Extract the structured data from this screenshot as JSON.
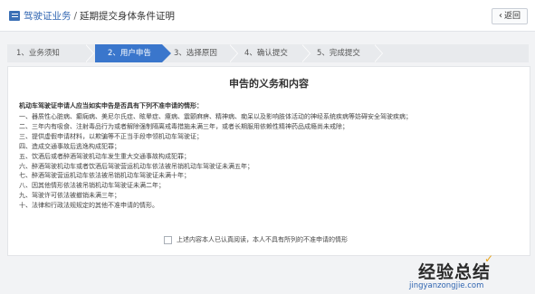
{
  "header": {
    "breadcrumb_link": "驾驶证业务",
    "separator": "/",
    "breadcrumb_current": "延期提交身体条件证明",
    "back_label": "返回"
  },
  "steps": [
    {
      "label": "1、业务须知",
      "active": false
    },
    {
      "label": "2、用户申告",
      "active": true
    },
    {
      "label": "3、选择原因",
      "active": false
    },
    {
      "label": "4、确认提交",
      "active": false
    },
    {
      "label": "5、完成提交",
      "active": false
    }
  ],
  "content": {
    "title": "申告的义务和内容",
    "intro": "机动车驾驶证申请人应当如实申告是否具有下列不准申请的情形：",
    "items": [
      "一、器质性心脏病、癫痫病、美尼尔氏症、眩晕症、癔病、震颤麻痹、精神病、痴呆以及影响肢体活动的神经系统疾病等妨碍安全驾驶疾病；",
      "二、三年内有吸食、注射毒品行为或者解除强制隔离戒毒措施未满三年，或者长期服用依赖性精神药品成瘾尚未戒除；",
      "三、提供虚假申请材料，以欺骗等不正当手段申领机动车驾驶证；",
      "四、造成交通事故后逃逸构成犯罪；",
      "五、饮酒后或者醉酒驾驶机动车发生重大交通事故构成犯罪；",
      "六、醉酒驾驶机动车或者饮酒后驾驶营运机动车依法被吊销机动车驾驶证未满五年；",
      "七、醉酒驾驶营运机动车依法被吊销机动车驾驶证未满十年；",
      "八、因其他情形依法被吊销机动车驾驶证未满二年；",
      "九、驾驶许可依法被撤销未满三年；",
      "十、法律和行政法规规定的其他不准申请的情形。"
    ],
    "agree_text": "上述内容本人已认真阅读，本人不具有所列的不准申请的情形"
  },
  "watermark": {
    "top": "经验总结",
    "url": "jingyanzongjie.com"
  }
}
